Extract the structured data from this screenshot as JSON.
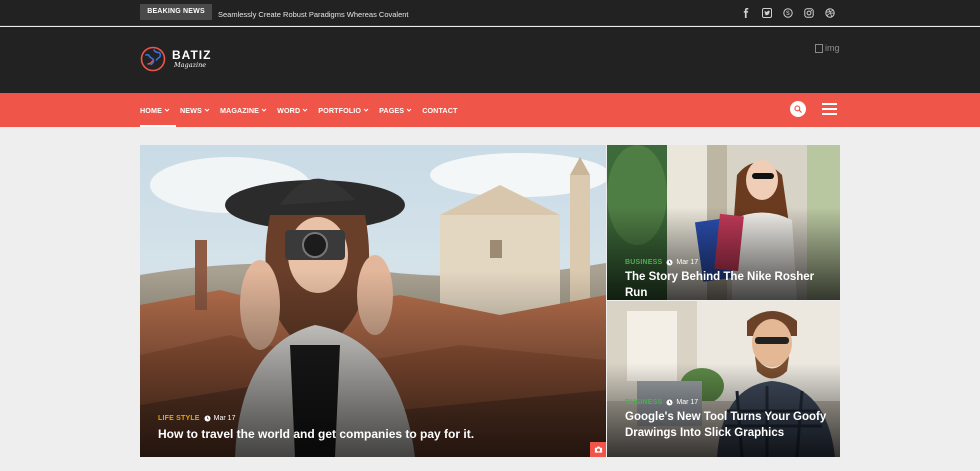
{
  "topbar": {
    "breaking_label": "BEAKING NEWS",
    "breaking_text": "Seamlessly Create Robust Paradigms Whereas Covalent",
    "socials": [
      "facebook-icon",
      "twitter-icon",
      "skype-icon",
      "instagram-icon",
      "dribbble-icon"
    ]
  },
  "header": {
    "logo_title": "BATIZ",
    "logo_sub": "Magazine",
    "ad_alt": "img"
  },
  "nav": {
    "items": [
      {
        "label": "HOME",
        "has_dropdown": true,
        "active": true
      },
      {
        "label": "NEWS",
        "has_dropdown": true
      },
      {
        "label": "MAGAZINE",
        "has_dropdown": true
      },
      {
        "label": "WORD",
        "has_dropdown": true
      },
      {
        "label": "PORTFOLIO",
        "has_dropdown": true
      },
      {
        "label": "PAGES",
        "has_dropdown": true
      },
      {
        "label": "CONTACT",
        "has_dropdown": false
      }
    ]
  },
  "posts": {
    "main": {
      "category": "LIFE STYLE",
      "date": "Mar 17",
      "title": "How to travel the world and get companies to pay for it."
    },
    "top": {
      "category": "BUSINESS",
      "date": "Mar 17",
      "title": "The Story Behind The Nike Rosher Run"
    },
    "bottom": {
      "category": "BUSINESS",
      "date": "Mar 17",
      "title": "Google's New Tool Turns Your Goofy Drawings Into Slick Graphics"
    }
  },
  "colors": {
    "accent": "#ef5548",
    "dark": "#222222",
    "lifestyle": "#f0a30a",
    "business": "#4caf50"
  }
}
